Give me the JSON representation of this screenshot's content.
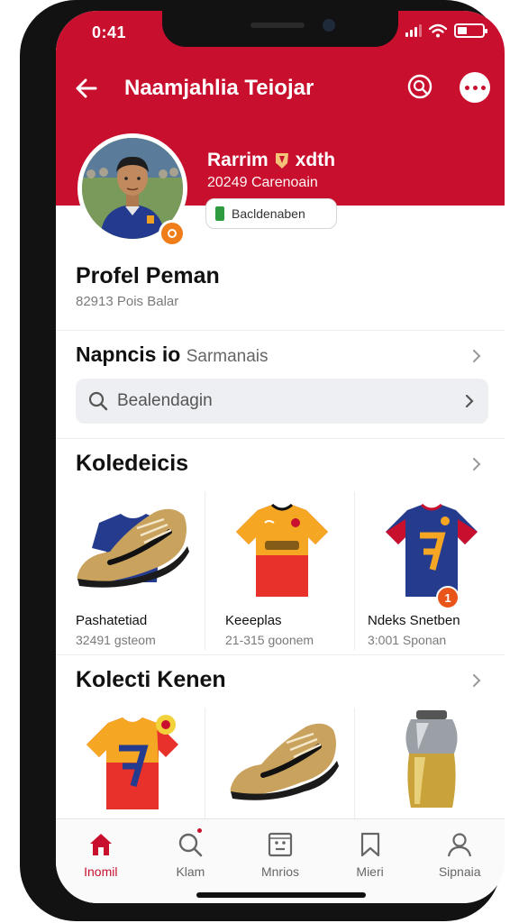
{
  "status_bar": {
    "time": "0:41"
  },
  "app_bar": {
    "title": "Naamjahlia Teiojar"
  },
  "profile": {
    "name": "Rarrim",
    "name_suffix": "xdth",
    "subtitle": "20249 Carenoain",
    "follow_label": "Bacldenaben",
    "section_title": "Profel Peman",
    "section_subtitle": "82913 Pois Balar"
  },
  "navigate": {
    "title_bold": "Napncis io",
    "title_light": "Sarmanais",
    "search_text": "Bealendagin"
  },
  "collections": [
    {
      "title": "Koledeicis",
      "items": [
        {
          "title": "Pashatetiad",
          "subtitle": "32491 gsteom",
          "icon": "boot"
        },
        {
          "title": "Keeeplas",
          "subtitle": "21-315 goonem",
          "icon": "jersey-orange"
        },
        {
          "title": "Ndeks Snetben",
          "subtitle": "3:001 Sponan",
          "icon": "jersey-blue",
          "badge": "1"
        }
      ]
    },
    {
      "title": "Kolecti Kenen",
      "items": [
        {
          "icon": "jersey-red-yellow"
        },
        {
          "icon": "boot"
        },
        {
          "icon": "trophy"
        }
      ]
    }
  ],
  "tabs": [
    {
      "label": "Inomil",
      "icon": "home-icon",
      "active": true
    },
    {
      "label": "Klam",
      "icon": "search-icon"
    },
    {
      "label": "Mnrios",
      "icon": "media-icon"
    },
    {
      "label": "Mieri",
      "icon": "bookmark-icon"
    },
    {
      "label": "Sipnaia",
      "icon": "profile-icon"
    }
  ],
  "colors": {
    "brand_red": "#c8102e",
    "accent_orange": "#ef7d1a",
    "green": "#2e9b3e"
  }
}
